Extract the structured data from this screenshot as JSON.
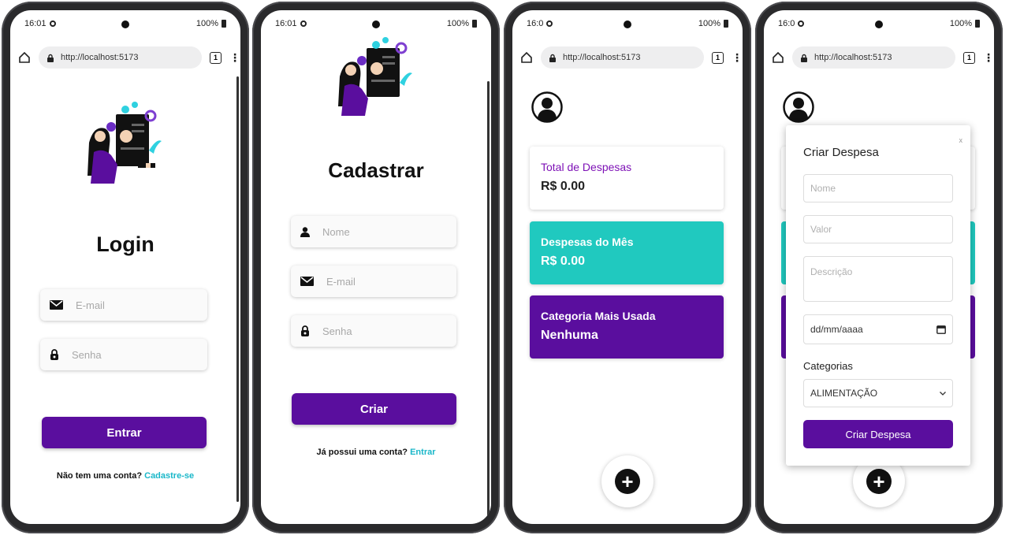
{
  "status_bar": {
    "phone1_time": "16:01",
    "phone2_time": "16:01",
    "phone3_time": "16:0",
    "phone4_time": "16:0",
    "signal_battery": "100%"
  },
  "browser": {
    "url": "http://localhost:5173"
  },
  "login": {
    "title": "Login",
    "email_placeholder": "E-mail",
    "password_placeholder": "Senha",
    "submit_label": "Entrar",
    "footer_text": "Não tem uma conta?",
    "footer_link": "Cadastre-se"
  },
  "register": {
    "title": "Cadastrar",
    "name_placeholder": "Nome",
    "email_placeholder": "E-mail",
    "password_placeholder": "Senha",
    "submit_label": "Criar",
    "footer_text": "Já possui uma conta?",
    "footer_link": "Entrar"
  },
  "dashboard": {
    "total_label": "Total de Despesas",
    "total_value": "R$ 0.00",
    "month_label": "Despesas do Mês",
    "month_value": "R$ 0.00",
    "category_label": "Categoria Mais Usada",
    "category_value": "Nenhuma",
    "fab_symbol": "+"
  },
  "modal": {
    "title": "Criar Despesa",
    "close_symbol": "x",
    "name_placeholder": "Nome",
    "value_placeholder": "Valor",
    "description_placeholder": "Descrição",
    "date_placeholder": "dd/mm/aaaa",
    "category_label": "Categorias",
    "category_selected": "ALIMENTAÇÃO",
    "submit_label": "Criar Despesa"
  },
  "colors": {
    "primary": "#5a0e9e",
    "accent_teal": "#20c9bf",
    "link_cyan": "#19b7c9",
    "text_purple": "#7e12b6"
  },
  "icons": [
    "home-icon",
    "lock-icon",
    "tabs-icon",
    "menu-icon",
    "mail-icon",
    "padlock-icon",
    "user-icon",
    "avatar-icon",
    "plus-icon",
    "calendar-icon",
    "chevron-down-icon",
    "close-icon"
  ]
}
